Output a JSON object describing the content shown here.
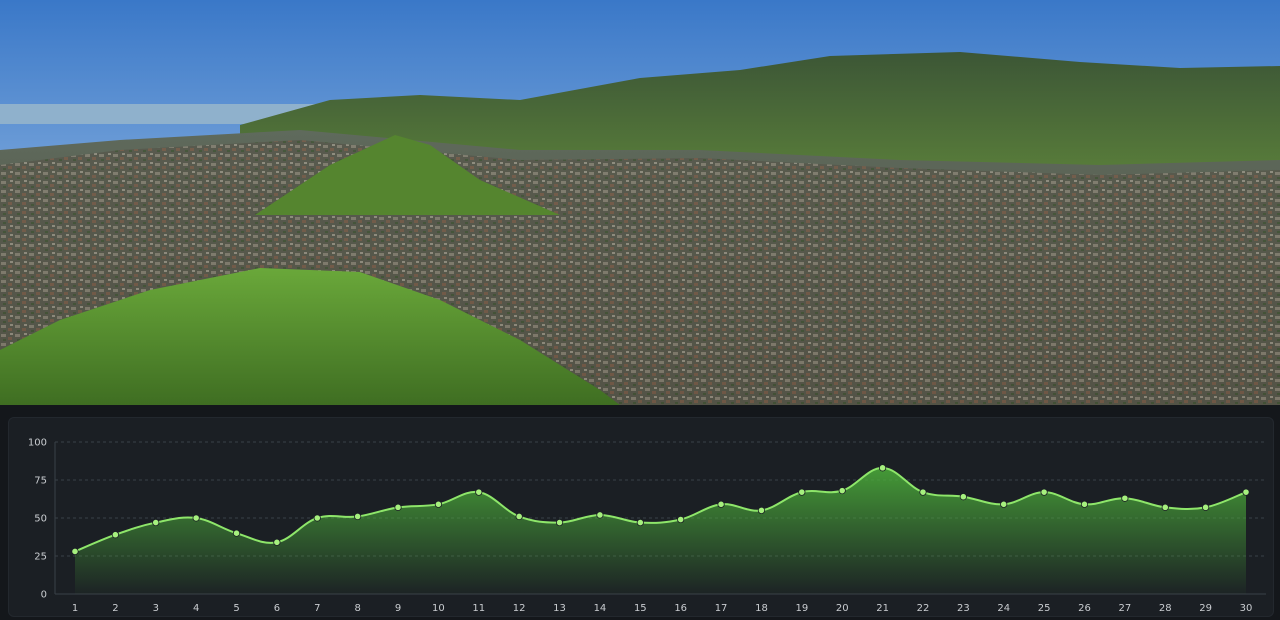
{
  "chart_data": {
    "type": "area",
    "title": "",
    "xlabel": "",
    "ylabel": "",
    "x": [
      1,
      2,
      3,
      4,
      5,
      6,
      7,
      8,
      9,
      10,
      11,
      12,
      13,
      14,
      15,
      16,
      17,
      18,
      19,
      20,
      21,
      22,
      23,
      24,
      25,
      26,
      27,
      28,
      29,
      30
    ],
    "series": [
      {
        "values": [
          28,
          39,
          47,
          50,
          40,
          34,
          50,
          51,
          57,
          59,
          67,
          51,
          47,
          52,
          47,
          49,
          59,
          55,
          67,
          68,
          83,
          67,
          64,
          59,
          67,
          59,
          63,
          57,
          57,
          67
        ]
      }
    ],
    "xlim": [
      1,
      30
    ],
    "ylim": [
      0,
      100
    ],
    "yticks": [
      "0",
      "25",
      "50",
      "75",
      "100"
    ],
    "grid": true,
    "legend": "none",
    "colors": {
      "line": "#8ee66a",
      "fill_top": "#4caf3a",
      "point": "#a6f07e",
      "grid": "#3a4047",
      "tick_text": "#c9ccd0"
    }
  },
  "hero": {
    "colors": {
      "sky_top": "#3f7fcf",
      "sky_bottom": "#b9d4ee",
      "mountain": "#3d5a38",
      "hill": "#5f9a34",
      "city": "#6d6a5e"
    }
  }
}
